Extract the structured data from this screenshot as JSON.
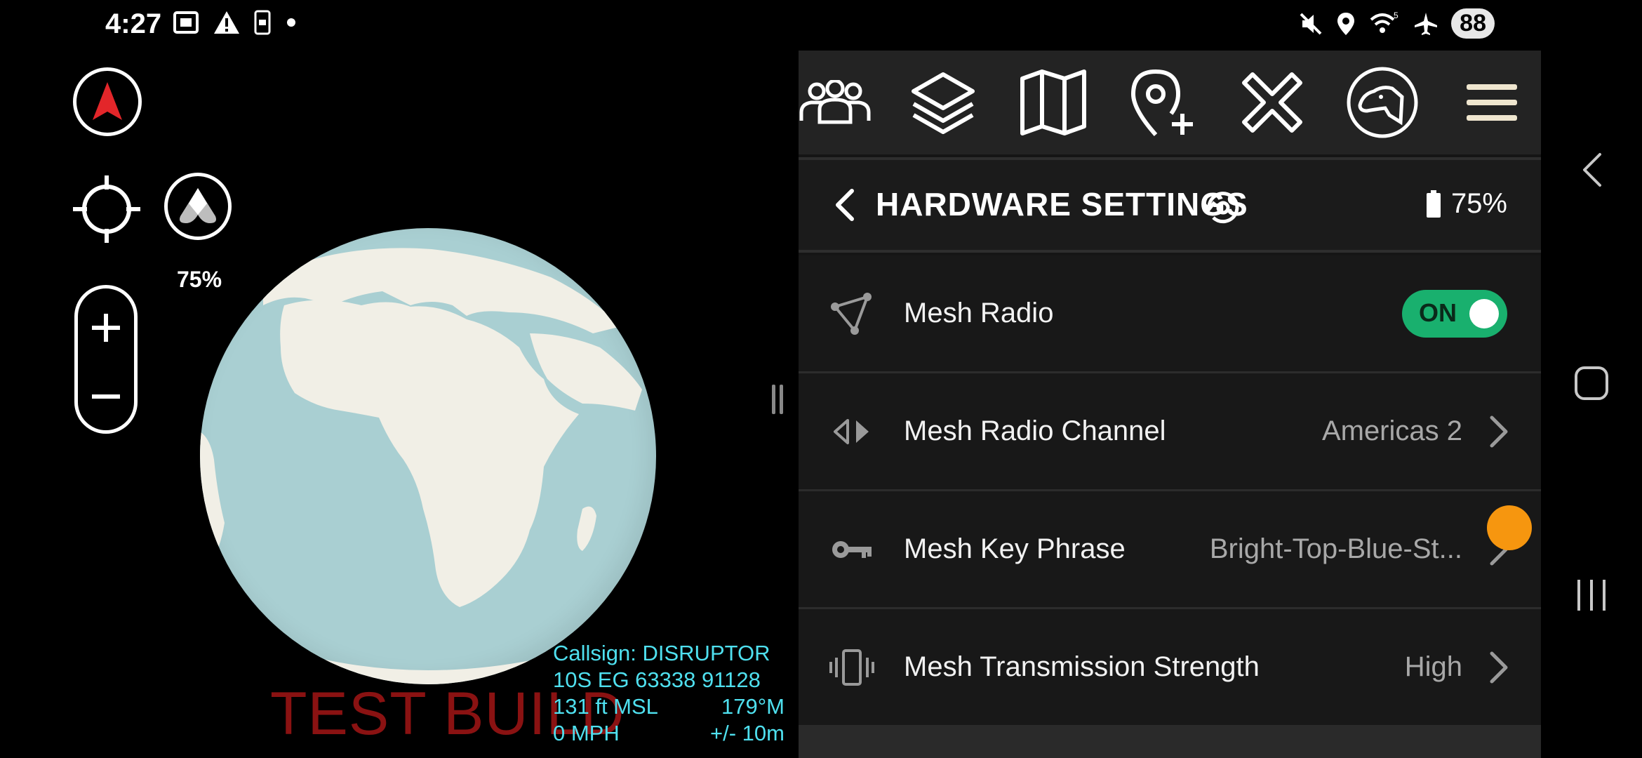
{
  "status_bar": {
    "time": "4:27",
    "battery": "88",
    "left_icons": [
      "screenshot-icon",
      "warning-icon",
      "phone-icon",
      "dot-icon"
    ],
    "right_icons": [
      "mute-icon",
      "location-icon",
      "wifi-icon",
      "airplane-icon"
    ]
  },
  "map": {
    "satellite_opacity": "75%",
    "watermark": "TEST BUILD",
    "info": {
      "callsign": "Callsign: DISRUPTOR",
      "grid": "10S  EG  63338  91128",
      "altitude": "131 ft MSL",
      "heading": "179°M",
      "speed": "0 MPH",
      "accuracy": "+/- 10m"
    },
    "colors": {
      "ocean": "#a9cfd2",
      "land": "#f1efe6",
      "info_text": "#4fe0ef",
      "watermark": "#8a1212"
    }
  },
  "toolbar": {
    "items": [
      "team-icon",
      "layers-icon",
      "map-icon",
      "add-pin-icon",
      "close-icon",
      "dog-icon",
      "menu-icon"
    ]
  },
  "header": {
    "title": "HARDWARE SETTINGS",
    "battery": "75%"
  },
  "settings": {
    "mesh_radio": {
      "label": "Mesh Radio",
      "toggle": "ON"
    },
    "mesh_channel": {
      "label": "Mesh Radio Channel",
      "value": "Americas 2"
    },
    "mesh_key": {
      "label": "Mesh Key Phrase",
      "value": "Bright-Top-Blue-St..."
    },
    "mesh_strength": {
      "label": "Mesh Transmission Strength",
      "value": "High"
    }
  },
  "accent_colors": {
    "toggle_on": "#19b06e",
    "floating_dot": "#f6960f"
  }
}
